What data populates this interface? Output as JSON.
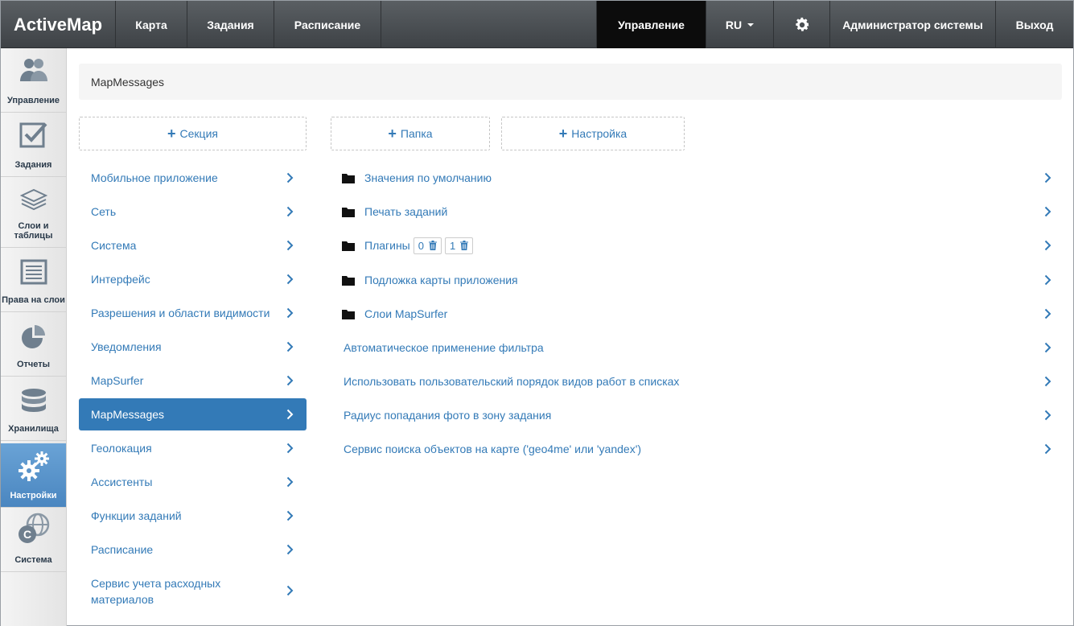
{
  "navbar": {
    "brand": "ActiveMap",
    "items": [
      {
        "label": "Карта"
      },
      {
        "label": "Задания"
      },
      {
        "label": "Расписание"
      }
    ],
    "manage": "Управление",
    "lang": "RU",
    "user": "Администратор системы",
    "logout": "Выход"
  },
  "sidebar": {
    "items": [
      {
        "label": "Управление",
        "icon": "users-icon"
      },
      {
        "label": "Задания",
        "icon": "checkbox-icon"
      },
      {
        "label": "Слои и таблицы",
        "icon": "layers-icon"
      },
      {
        "label": "Права на слои",
        "icon": "list-icon"
      },
      {
        "label": "Отчеты",
        "icon": "pie-chart-icon"
      },
      {
        "label": "Хранилища",
        "icon": "database-icon"
      },
      {
        "label": "Настройки",
        "icon": "gears-icon"
      },
      {
        "label": "Система",
        "icon": "globe-icon"
      }
    ]
  },
  "breadcrumb": "MapMessages",
  "buttons": {
    "section": "Секция",
    "folder": "Папка",
    "setting": "Настройка"
  },
  "sections": [
    "Мобильное приложение",
    "Сеть",
    "Система",
    "Интерфейс",
    "Разрешения и области видимости",
    "Уведомления",
    "MapSurfer",
    "MapMessages",
    "Геолокация",
    "Ассистенты",
    "Функции заданий",
    "Расписание",
    "Сервис учета расходных материалов"
  ],
  "settings": [
    {
      "label": "Значения по умолчанию",
      "folder": true
    },
    {
      "label": "Печать заданий",
      "folder": true
    },
    {
      "label": "Плагины",
      "folder": true,
      "badges": [
        "0",
        "1"
      ]
    },
    {
      "label": "Подложка карты приложения",
      "folder": true
    },
    {
      "label": "Слои MapSurfer",
      "folder": true
    },
    {
      "label": "Автоматическое применение фильтра",
      "folder": false
    },
    {
      "label": "Использовать пользовательский порядок видов работ в списках",
      "folder": false
    },
    {
      "label": "Радиус попадания фото в зону задания",
      "folder": false
    },
    {
      "label": "Сервис поиска объектов на карте ('geo4me' или 'yandex')",
      "folder": false
    }
  ],
  "colors": {
    "accent": "#337ab7",
    "navbar": "#4a4e52",
    "active_nav": "#0c0c0c"
  }
}
